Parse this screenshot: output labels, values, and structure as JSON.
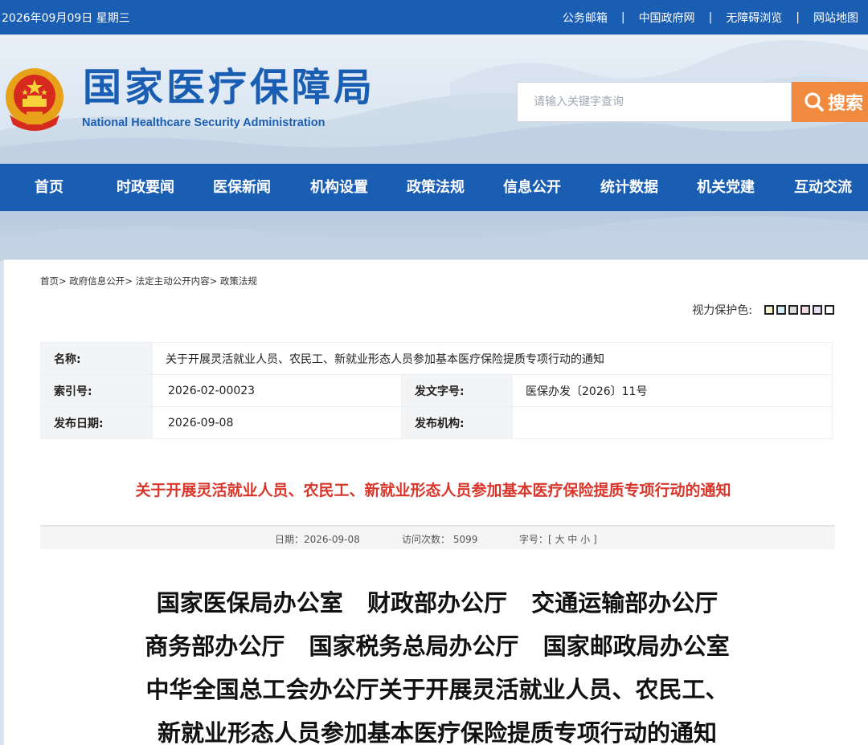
{
  "topbar": {
    "date": "2026年09月09日 星期三",
    "links": [
      "公务邮箱",
      "中国政府网",
      "无障碍浏览",
      "网站地图"
    ],
    "separator": "|"
  },
  "header": {
    "title": "国家医疗保障局",
    "subtitle": "National Healthcare Security Administration",
    "emblem_icon": "national-emblem-icon"
  },
  "search": {
    "placeholder": "请输入关键字查询",
    "button_label": "搜索",
    "button_icon": "search-icon"
  },
  "nav": {
    "items": [
      "首页",
      "时政要闻",
      "医保新闻",
      "机构设置",
      "政策法规",
      "信息公开",
      "统计数据",
      "机关党建",
      "互动交流"
    ]
  },
  "breadcrumb": [
    "首页>",
    "政府信息公开>",
    "法定主动公开内容>",
    "政策法规"
  ],
  "eye_care": {
    "label": "视力保护色:",
    "swatches": [
      "#f7f1cc",
      "#d6ecf6",
      "#dcdcdc",
      "#f7dbe3",
      "#e8dcf5",
      "#ffffff"
    ]
  },
  "meta": {
    "name_label": "名称:",
    "name_value": "关于开展灵活就业人员、农民工、新就业形态人员参加基本医疗保险提质专项行动的通知",
    "index_label": "索引号:",
    "index_value": "2026-02-00023",
    "doc_no_label": "发文字号:",
    "doc_no_value": "医保办发〔2026〕11号",
    "date_label": "发布日期:",
    "date_value": "2026-09-08",
    "org_label": "发布机构:",
    "org_value": ""
  },
  "article": {
    "red_title": "关于开展灵活就业人员、农民工、新就业形态人员参加基本医疗保险提质专项行动的通知",
    "info": {
      "date": "日期：2026-09-08",
      "visits": "访问次数：  5099",
      "font_size": "字号：[ 大 中 小 ]"
    },
    "doc_title_lines": [
      "国家医保局办公室   财政部办公厅   交通运输部办公厅",
      "商务部办公厅   国家税务总局办公厅   国家邮政局办公室",
      "中华全国总工会办公厅关于开展灵活就业人员、农民工、",
      "新就业形态人员参加基本医疗保险提质专项行动的通知"
    ]
  },
  "colors": {
    "brand_blue": "#1a5eb3",
    "search_orange": "#f08a3e",
    "title_red": "#d9362b"
  }
}
